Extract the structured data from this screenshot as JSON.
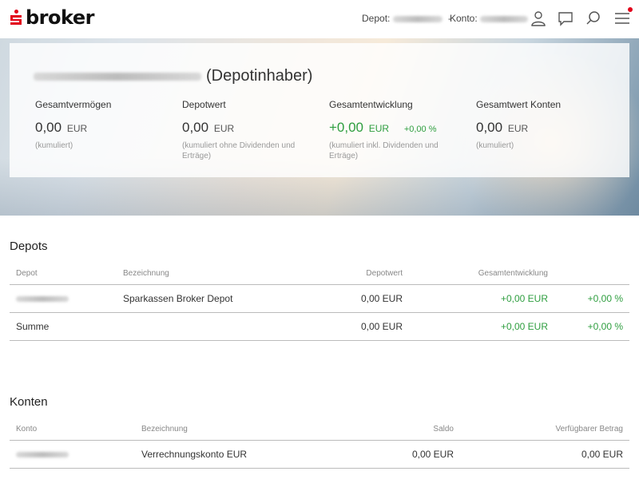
{
  "brand": {
    "name": "broker",
    "accent": "#e2001a"
  },
  "header": {
    "depot_label": "Depot:",
    "separator": "-",
    "konto_label": "Konto:",
    "icons": [
      "user-icon",
      "chat-icon",
      "search-icon",
      "menu-icon"
    ]
  },
  "summary": {
    "owner_suffix": "(Depotinhaber)",
    "stats": [
      {
        "label": "Gesamtvermögen",
        "value": "0,00",
        "currency": "EUR",
        "note": "(kumuliert)"
      },
      {
        "label": "Depotwert",
        "value": "0,00",
        "currency": "EUR",
        "note": "(kumuliert ohne Dividenden und Erträge)"
      },
      {
        "label": "Gesamtentwicklung",
        "value": "+0,00",
        "currency": "EUR",
        "pct": "+0,00 %",
        "note": "(kumuliert inkl. Dividenden und Erträge)"
      },
      {
        "label": "Gesamtwert Konten",
        "value": "0,00",
        "currency": "EUR",
        "note": "(kumuliert)"
      }
    ]
  },
  "depots": {
    "title": "Depots",
    "columns": [
      "Depot",
      "Bezeichnung",
      "Depotwert",
      "Gesamtentwicklung"
    ],
    "rows": [
      {
        "bezeichnung": "Sparkassen Broker Depot",
        "depotwert": "0,00 EUR",
        "entwicklung": "+0,00 EUR",
        "pct": "+0,00 %"
      }
    ],
    "sum": {
      "label": "Summe",
      "depotwert": "0,00 EUR",
      "entwicklung": "+0,00 EUR",
      "pct": "+0,00 %"
    }
  },
  "konten": {
    "title": "Konten",
    "columns": [
      "Konto",
      "Bezeichnung",
      "Saldo",
      "Verfügbarer Betrag"
    ],
    "rows": [
      {
        "bezeichnung": "Verrechnungskonto EUR",
        "saldo": "0,00 EUR",
        "verfuegbar": "0,00 EUR"
      }
    ]
  }
}
